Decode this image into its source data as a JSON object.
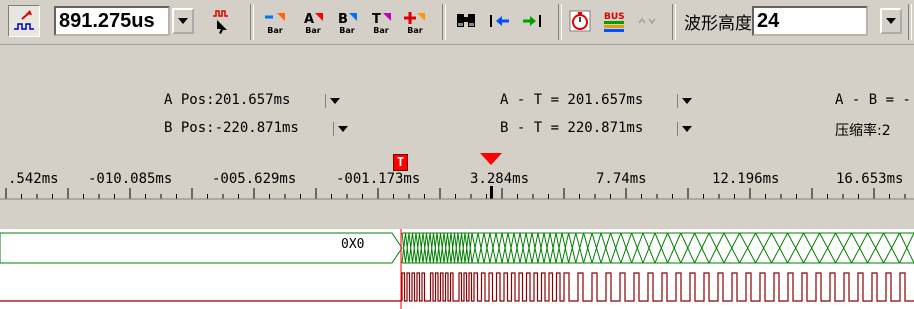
{
  "toolbar": {
    "time_value": "891.275us",
    "bar_labels": [
      "Bar",
      "Bar",
      "Bar",
      "Bar",
      "Bar"
    ],
    "bus_label": "BUS",
    "height_label": "波形高度",
    "height_value": "24"
  },
  "info": {
    "a_pos": "A Pos:201.657ms",
    "b_pos": "B Pos:-220.871ms",
    "a_t": "A - T = 201.657ms",
    "b_t": "B - T = 220.871ms",
    "a_b": "A - B = -",
    "compress": "压缩率:2"
  },
  "ruler": {
    "trigger_label": "T",
    "ticks": [
      ".542ms",
      "-010.085ms",
      "-005.629ms",
      "-001.173ms",
      "3.284ms",
      "7.74ms",
      "12.196ms",
      "16.653ms"
    ]
  },
  "waveform": {
    "value_label": "0X0"
  },
  "colors": {
    "green": "#008000",
    "red": "#8b0000",
    "trigger": "#ff0000"
  }
}
